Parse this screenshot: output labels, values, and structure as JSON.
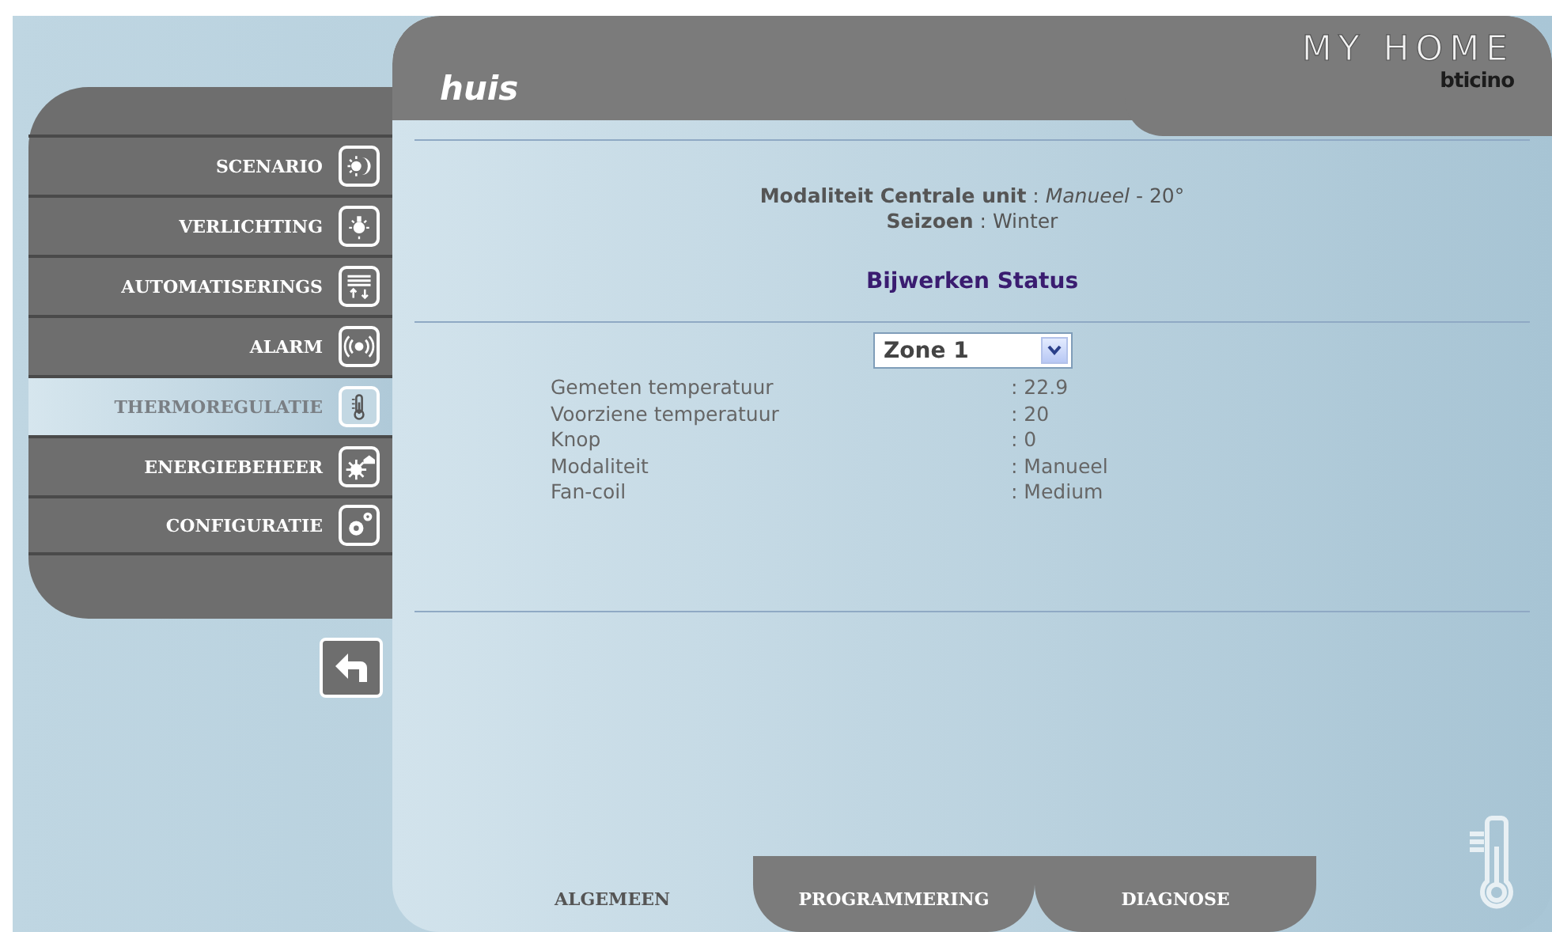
{
  "window": {
    "title": "huis"
  },
  "logo": {
    "brand": "MY HOME",
    "maker": "bticino"
  },
  "sidebar": {
    "items": [
      {
        "label": "SCENARIO",
        "selected": false
      },
      {
        "label": "VERLICHTING",
        "selected": false
      },
      {
        "label": "AUTOMATISERINGS",
        "selected": false
      },
      {
        "label": "ALARM",
        "selected": false
      },
      {
        "label": "THERMOREGULATIE",
        "selected": true
      },
      {
        "label": "ENERGIEBEHEER",
        "selected": false
      },
      {
        "label": "CONFIGURATIE",
        "selected": false
      }
    ]
  },
  "status": {
    "lines": [
      "**Modaliteit Centrale unit** : *Manueel* - 20°",
      "**Seizoen** : Winter"
    ],
    "update_link": "Bijwerken Status"
  },
  "zone_select": {
    "value": "Zone 1"
  },
  "readings": [
    {
      "label": "Gemeten temperatuur",
      "value": ": 22.9"
    },
    {
      "label": "Voorziene temperatuur",
      "value": ": 20"
    },
    {
      "label": "Knop",
      "value": ": 0"
    },
    {
      "label": "Modaliteit",
      "value": ": Manueel"
    },
    {
      "label": "Fan-coil",
      "value": ": Medium"
    }
  ],
  "tabs": [
    {
      "label": "ALGEMEEN",
      "selected": true
    },
    {
      "label": "PROGRAMMERING",
      "selected": false
    },
    {
      "label": "DIAGNOSE",
      "selected": false
    }
  ]
}
